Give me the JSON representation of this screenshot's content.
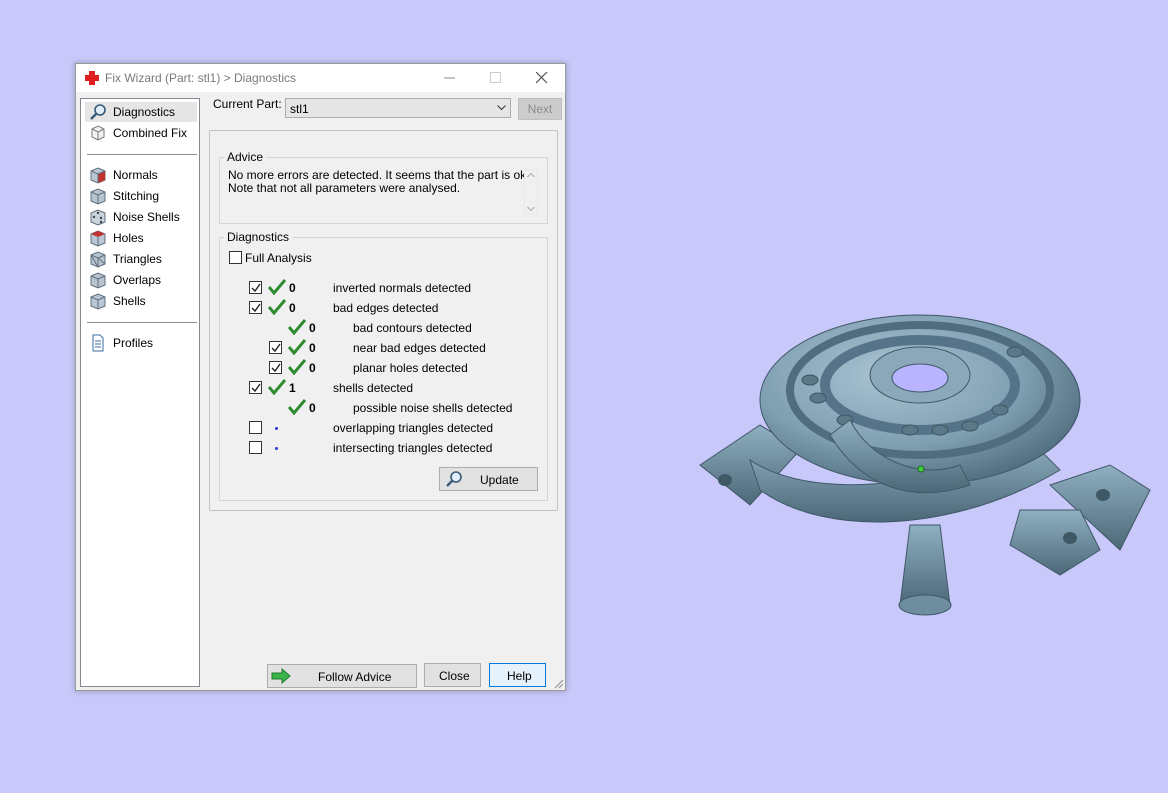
{
  "window": {
    "title": "Fix Wizard (Part: stl1) > Diagnostics"
  },
  "nav": {
    "items": [
      {
        "label": "Diagnostics",
        "icon": "magnifier-icon"
      },
      {
        "label": "Combined Fix",
        "icon": "cube-icon"
      },
      {
        "label": "Normals",
        "icon": "normals-cube-icon"
      },
      {
        "label": "Stitching",
        "icon": "stitching-cube-icon"
      },
      {
        "label": "Noise Shells",
        "icon": "noise-shells-cube-icon"
      },
      {
        "label": "Holes",
        "icon": "holes-cube-icon"
      },
      {
        "label": "Triangles",
        "icon": "triangles-cube-icon"
      },
      {
        "label": "Overlaps",
        "icon": "overlaps-cube-icon"
      },
      {
        "label": "Shells",
        "icon": "shells-cube-icon"
      },
      {
        "label": "Profiles",
        "icon": "document-icon"
      }
    ]
  },
  "current_part": {
    "label": "Current Part:",
    "value": "stl1"
  },
  "next_label": "Next",
  "advice": {
    "legend": "Advice",
    "line1": "No more errors are detected. It seems that the part is ok.",
    "line2": "Note that not all parameters were analysed."
  },
  "diagnostics": {
    "legend": "Diagnostics",
    "full_analysis": "Full Analysis",
    "rows": [
      {
        "count": "0",
        "label": "inverted normals detected",
        "checked": true
      },
      {
        "count": "0",
        "label": "bad edges detected",
        "checked": true
      },
      {
        "count": "0",
        "label": "bad contours detected"
      },
      {
        "count": "0",
        "label": "near bad edges detected",
        "checked": true
      },
      {
        "count": "0",
        "label": "planar holes detected",
        "checked": true
      },
      {
        "count": "1",
        "label": "shells detected",
        "checked": true
      },
      {
        "count": "0",
        "label": "possible noise shells detected"
      },
      {
        "count": "",
        "label": "overlapping triangles detected",
        "checked": false
      },
      {
        "count": "",
        "label": "intersecting triangles detected",
        "checked": false
      }
    ],
    "update_label": "Update"
  },
  "buttons": {
    "follow_advice": "Follow Advice",
    "close": "Close",
    "help": "Help"
  },
  "colors": {
    "background": "#c8c8fa",
    "tick": "#2e8b2e",
    "model": "#7f9fb2"
  }
}
